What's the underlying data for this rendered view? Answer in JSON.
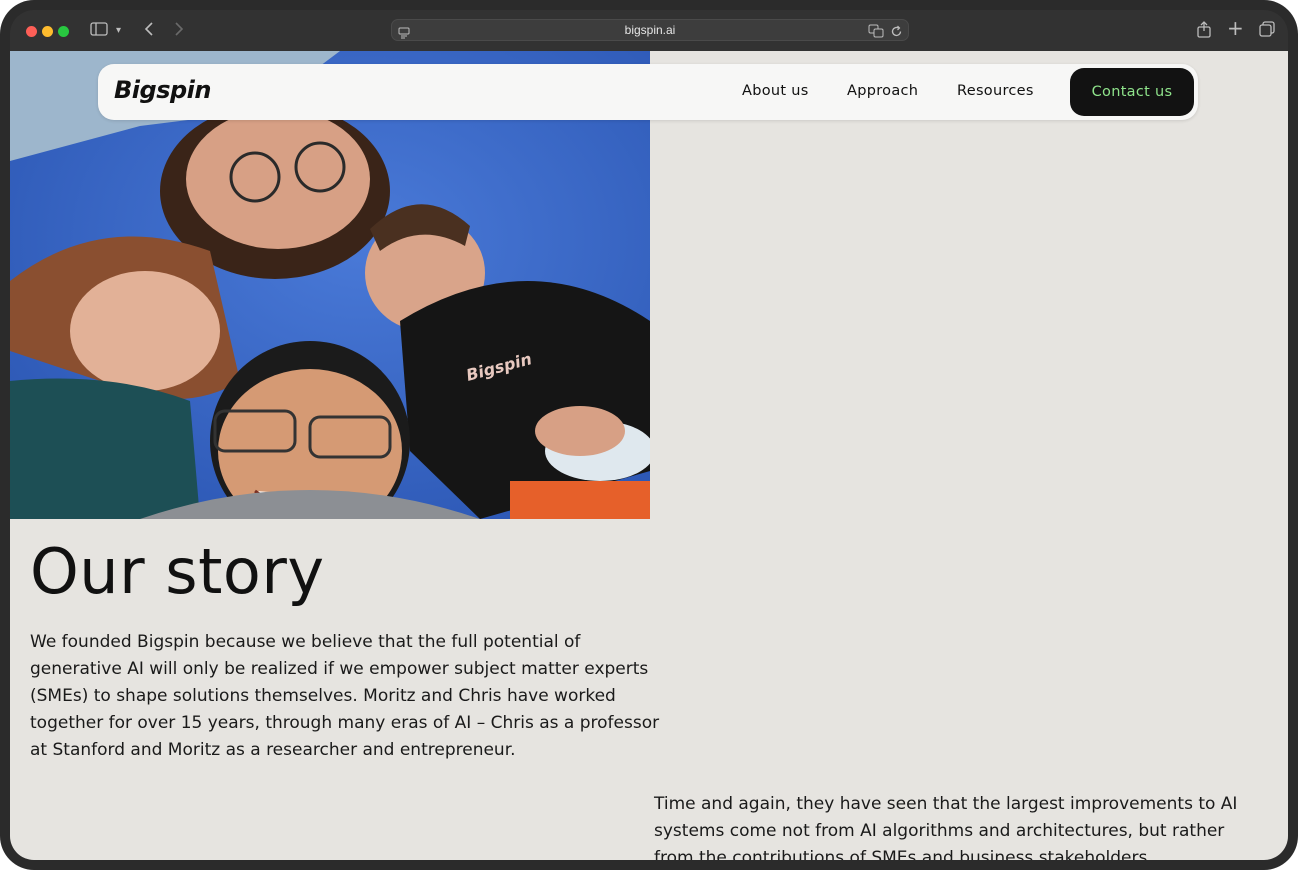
{
  "browser": {
    "url": "bigspin.ai"
  },
  "nav": {
    "logo": "Bigspin",
    "links": [
      "About us",
      "Approach",
      "Resources"
    ],
    "contact_label": "Contact us"
  },
  "hero": {
    "shirt_logo": "Bigspin"
  },
  "story": {
    "title": "Our story",
    "paragraph1": "We founded Bigspin because we believe that the full potential of generative AI will only be realized if we empower subject matter experts (SMEs) to shape solutions themselves. Moritz and Chris have worked together for over 15 years, through many eras of AI – Chris as a professor at Stanford and Moritz as a researcher and entrepreneur.",
    "paragraph2": "Time and again, they have seen that the largest improvements to AI systems come not from AI algorithms and architectures, but rather from the contributions of SMEs and business stakeholders."
  },
  "colors": {
    "page_bg": "#e6e4e0",
    "contact_bg": "#121212",
    "contact_text": "#8fe38b",
    "sky": "#3f6ed0"
  }
}
